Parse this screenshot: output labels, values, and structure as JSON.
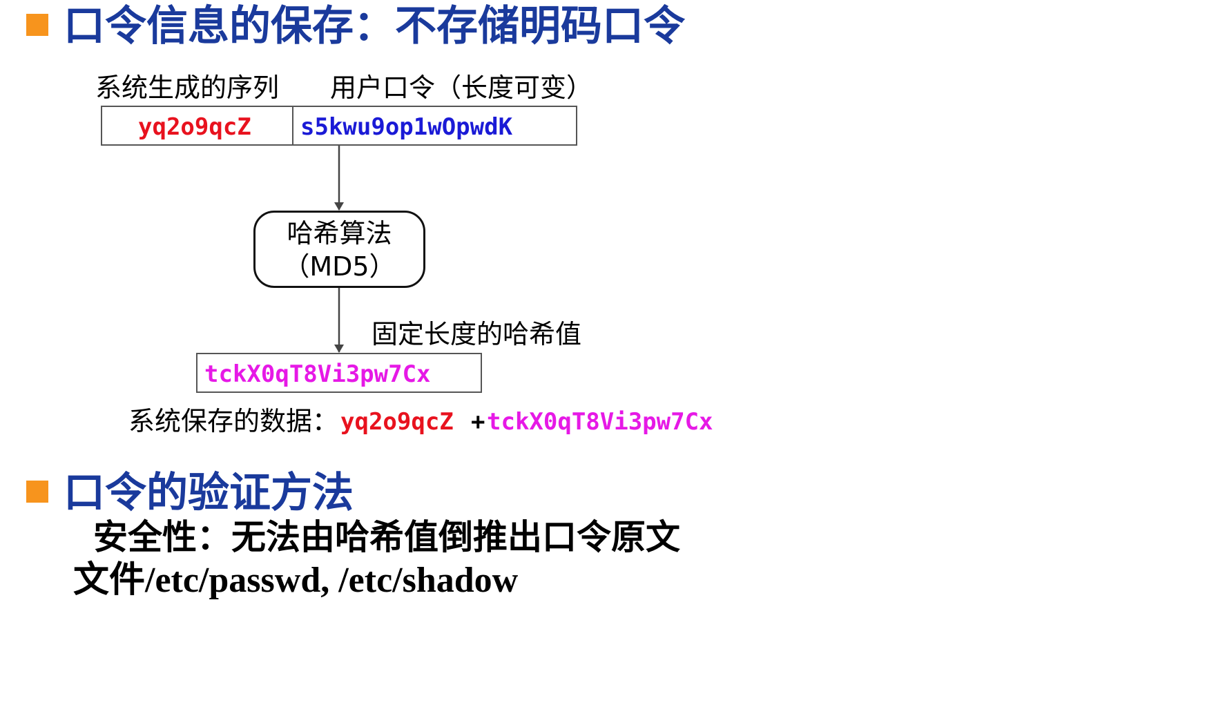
{
  "section1": {
    "title": "口令信息的保存：不存储明码口令"
  },
  "diagram": {
    "label_salt": "系统生成的序列",
    "label_password": "用户口令（长度可变）",
    "salt_value": "yq2o9qcZ",
    "password_value": "s5kwu9op1wOpwdK",
    "hash_title": "哈希算法",
    "hash_subtitle": "（MD5）",
    "label_hash": "固定长度的哈希值",
    "hash_value": "tckX0qT8Vi3pw7Cx",
    "stored_label": "系统保存的数据：",
    "stored_salt": "yq2o9qcZ",
    "stored_plus": "+",
    "stored_hash": "tckX0qT8Vi3pw7Cx",
    "colors": {
      "salt": "#e8121e",
      "password": "#1a1ad6",
      "hash": "#e619e6",
      "plus": "#000000"
    }
  },
  "section2": {
    "title": "口令的验证方法",
    "security_line": "安全性：无法由哈希值倒推出口令原文",
    "files_line": "文件/etc/passwd, /etc/shadow"
  },
  "colors": {
    "heading": "#1a3a9c",
    "bullet": "#f7941d"
  }
}
